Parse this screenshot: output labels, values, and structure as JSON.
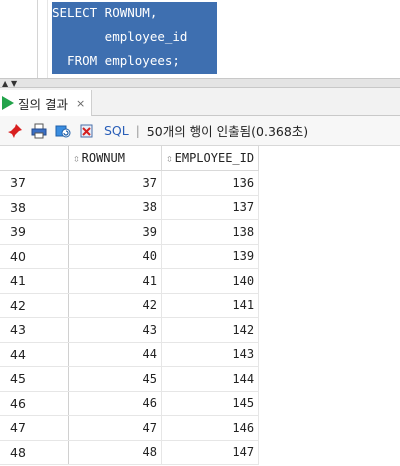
{
  "editor": {
    "lines": [
      "SELECT ROWNUM,",
      "       employee_id",
      "  FROM employees;"
    ]
  },
  "results_tab": {
    "label": "질의 결과",
    "close": "×"
  },
  "toolbar": {
    "sql_label": "SQL",
    "separator": "|",
    "status": "50개의 행이 인출됨(0.368초)",
    "icons": [
      "pin-icon",
      "print-icon",
      "refresh-icon",
      "export-icon"
    ]
  },
  "grid": {
    "columns": [
      "",
      "ROWNUM",
      "EMPLOYEE_ID"
    ],
    "sort_glyph": "⇳",
    "rows": [
      [
        "37",
        "37",
        "136"
      ],
      [
        "38",
        "38",
        "137"
      ],
      [
        "39",
        "39",
        "138"
      ],
      [
        "40",
        "40",
        "139"
      ],
      [
        "41",
        "41",
        "140"
      ],
      [
        "42",
        "42",
        "141"
      ],
      [
        "43",
        "43",
        "142"
      ],
      [
        "44",
        "44",
        "143"
      ],
      [
        "45",
        "45",
        "144"
      ],
      [
        "46",
        "46",
        "145"
      ],
      [
        "47",
        "47",
        "146"
      ],
      [
        "48",
        "48",
        "147"
      ]
    ]
  },
  "colors": {
    "selection": "#3e6fb0",
    "play": "#22a34a",
    "sql_link": "#2a5fb8"
  }
}
